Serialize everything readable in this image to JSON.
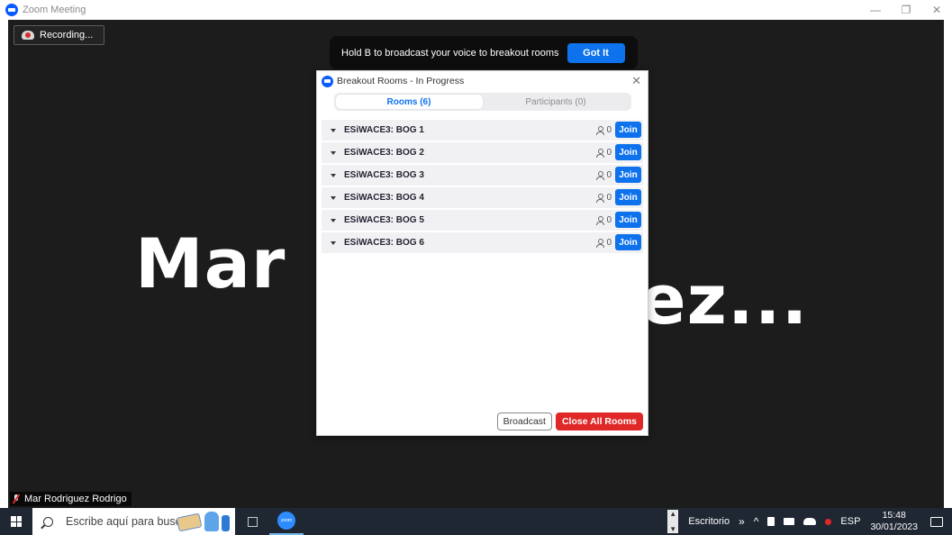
{
  "window": {
    "title": "Zoom Meeting",
    "minimize_icon": "—",
    "restore_icon": "❐",
    "close_icon": "✕"
  },
  "meeting": {
    "recording_label": "Recording...",
    "big_name_left": "Mar",
    "big_name_right": "uez...",
    "speaker_name": "Mar Rodriguez Rodrigo"
  },
  "toast": {
    "text": "Hold B to broadcast your voice to breakout rooms",
    "button_label": "Got It"
  },
  "breakout": {
    "title": "Breakout Rooms - In Progress",
    "close_icon": "✕",
    "tabs": [
      {
        "label": "Rooms (6)",
        "active": true
      },
      {
        "label": "Participants (0)",
        "active": false
      }
    ],
    "rooms": [
      {
        "name": "ESiWACE3: BOG 1",
        "count": "0",
        "join_label": "Join"
      },
      {
        "name": "ESiWACE3: BOG 2",
        "count": "0",
        "join_label": "Join"
      },
      {
        "name": "ESiWACE3: BOG 3",
        "count": "0",
        "join_label": "Join"
      },
      {
        "name": "ESiWACE3: BOG 4",
        "count": "0",
        "join_label": "Join"
      },
      {
        "name": "ESiWACE3: BOG 5",
        "count": "0",
        "join_label": "Join"
      },
      {
        "name": "ESiWACE3: BOG 6",
        "count": "0",
        "join_label": "Join"
      }
    ],
    "broadcast_label": "Broadcast",
    "close_all_label": "Close All Rooms"
  },
  "taskbar": {
    "search_placeholder": "Escribe aquí para buscar",
    "zoom_icon_text": "zoom",
    "desktop_label": "Escritorio",
    "chevron_glyph": "»",
    "tray_up_glyph": "^",
    "language": "ESP",
    "time": "15:48",
    "date": "30/01/2023"
  },
  "colors": {
    "meeting_bg": "#1c1c1c",
    "zoom_blue": "#0e72ed",
    "danger_red": "#e02828",
    "taskbar_bg": "#1f2733"
  }
}
